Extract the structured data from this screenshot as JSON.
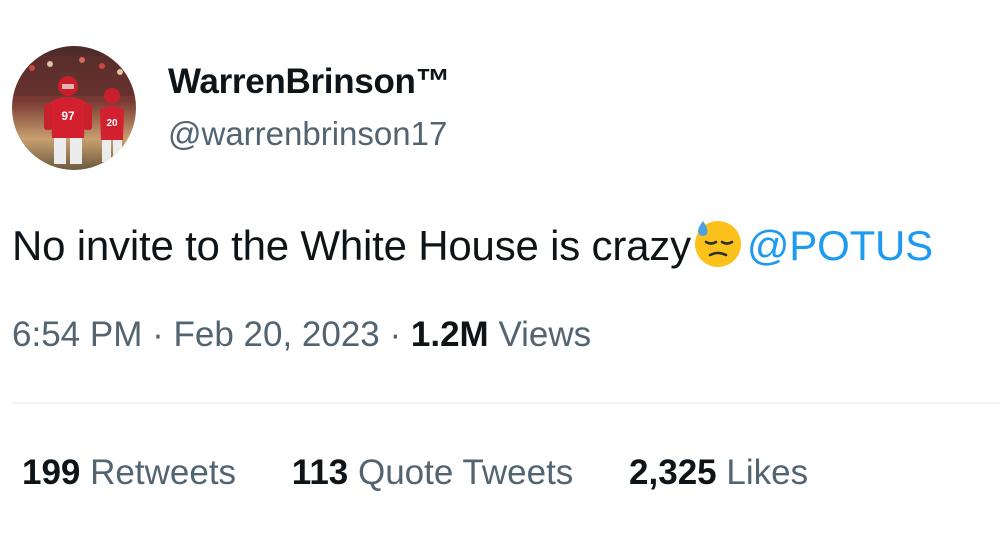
{
  "author": {
    "display_name": "WarrenBrinson™",
    "handle": "@warrenbrinson17",
    "avatar_jersey_numbers": [
      "97",
      "20"
    ]
  },
  "tweet": {
    "text_before": "No invite to the White House is crazy",
    "emoji": "downcast-face-with-sweat-icon",
    "mention": "@POTUS"
  },
  "meta": {
    "time": "6:54 PM",
    "separator": "·",
    "date": "Feb 20, 2023",
    "views_count": "1.2M",
    "views_label": "Views"
  },
  "stats": {
    "retweets": {
      "count": "199",
      "label": "Retweets"
    },
    "quote_tweets": {
      "count": "113",
      "label": "Quote Tweets"
    },
    "likes": {
      "count": "2,325",
      "label": "Likes"
    }
  },
  "colors": {
    "text_primary": "#0f1419",
    "text_secondary": "#536471",
    "link": "#1d9bf0",
    "divider": "#eff3f4",
    "jersey_red": "#d2202f"
  }
}
